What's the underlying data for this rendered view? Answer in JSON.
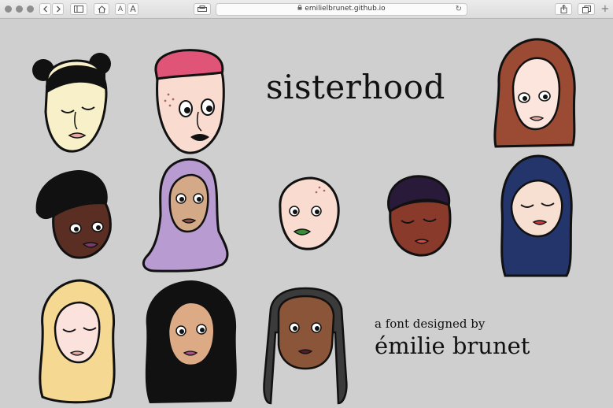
{
  "browser": {
    "url": "emilielbrunet.github.io",
    "icons": [
      "back-icon",
      "forward-icon",
      "sidebar-icon",
      "home-icon",
      "text-smaller",
      "text-larger",
      "reader-icon",
      "lock-icon",
      "reload-icon",
      "share-icon",
      "tabs-icon",
      "new-tab-icon"
    ],
    "text_small": "A",
    "text_large": "A",
    "new_tab": "+"
  },
  "page": {
    "title": "sisterhood",
    "subtitle": "a font designed by",
    "author": "émilie brunet"
  },
  "colors": {
    "background": "#cfcfcf",
    "outline": "#111111"
  }
}
